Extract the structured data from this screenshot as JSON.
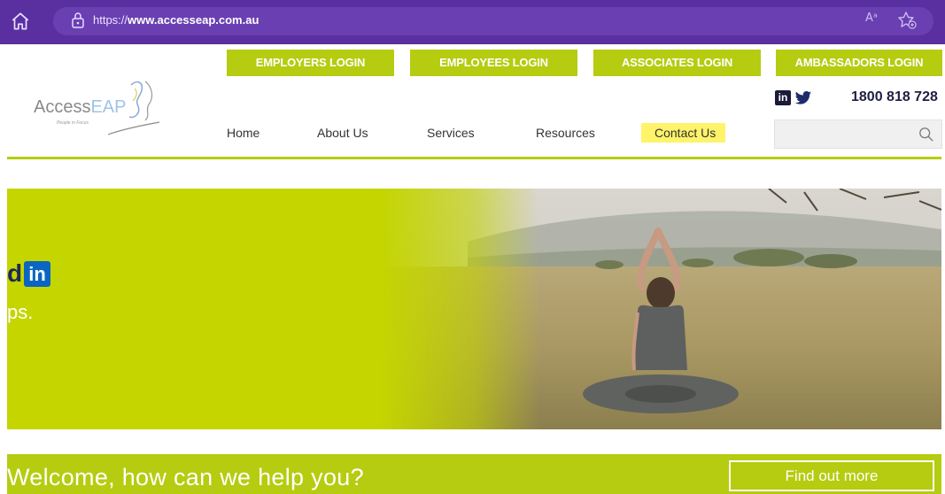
{
  "browser": {
    "url_prefix": "https://",
    "url_domain": "www.accesseap.com.au",
    "read_aloud_label": "Aᵃ"
  },
  "logins": [
    {
      "label": "EMPLOYERS LOGIN"
    },
    {
      "label": "EMPLOYEES LOGIN"
    },
    {
      "label": "ASSOCIATES LOGIN"
    },
    {
      "label": "AMBASSADORS LOGIN"
    }
  ],
  "logo": {
    "name_part1": "Access",
    "name_part2": "EAP",
    "tagline": "People in Focus"
  },
  "social": {
    "linkedin_label": "in"
  },
  "phone": "1800 818 728",
  "nav": {
    "home": "Home",
    "about": "About Us",
    "services": "Services",
    "resources": "Resources",
    "contact": "Contact Us"
  },
  "search": {
    "value": "",
    "placeholder": ""
  },
  "hero": {
    "line1": "d",
    "linkedin_label": "in",
    "line2": "ps."
  },
  "welcome": {
    "title": "Welcome, how can we help you?",
    "button": "Find out more"
  },
  "colors": {
    "brand_green": "#b5cc10",
    "browser_purple": "#5a2fa0",
    "highlight": "#fff36a",
    "navy": "#1f2b52"
  }
}
